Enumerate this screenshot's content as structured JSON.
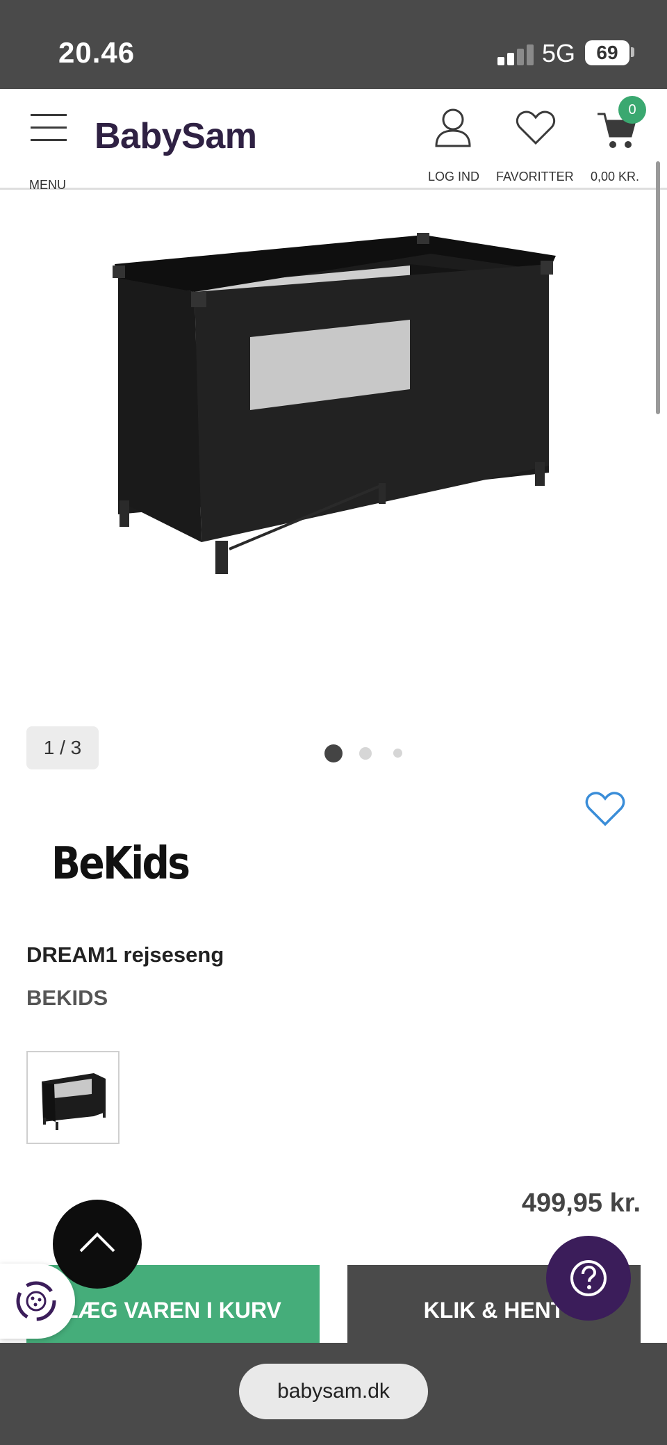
{
  "status_bar": {
    "time": "20.46",
    "network": "5G",
    "battery": "69"
  },
  "header": {
    "menu_label": "MENU",
    "logo_text": "BabySam",
    "login_label": "LOG IND",
    "favorites_label": "FAVORITTER",
    "cart_total": "0,00 KR.",
    "cart_count": "0"
  },
  "gallery": {
    "counter": "1 / 3",
    "total_images": 3,
    "active_index": 0
  },
  "product": {
    "brand_logo_text": "BeKids",
    "title": "DREAM1 rejseseng",
    "brand": "BEKIDS",
    "price": "499,95 kr."
  },
  "actions": {
    "add_to_cart_label": "LÆG VAREN I KURV",
    "click_collect_label": "KLIK & HENT"
  },
  "browser": {
    "url": "babysam.dk"
  },
  "colors": {
    "brand_purple": "#2f2143",
    "green": "#45ad7a",
    "dark_gray": "#4a4a4a",
    "help_purple": "#3b1d5a",
    "heart_blue": "#3a8dd8"
  }
}
